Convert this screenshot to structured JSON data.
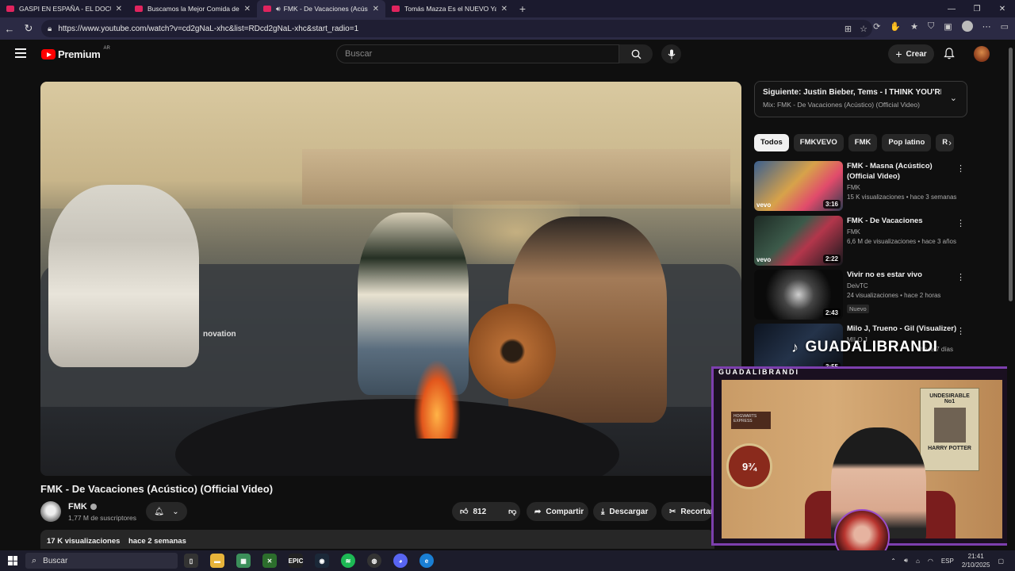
{
  "browser": {
    "tabs": [
      {
        "title": "GASPI EN ESPAÑA - EL DOCUMENTAL",
        "active": false,
        "audio": false
      },
      {
        "title": "Buscamos la Mejor Comida de España",
        "active": false,
        "audio": false
      },
      {
        "title": "FMK - De Vacaciones (Acústico)",
        "active": true,
        "audio": true
      },
      {
        "title": "Tomás Mazza Es el NUEVO Yao Cabrera",
        "active": false,
        "audio": false
      }
    ],
    "url": "https://www.youtube.com/watch?v=cd2gNaL-xhc&list=RDcd2gNaL-xhc&start_radio=1"
  },
  "youtube": {
    "logo_text": "Premium",
    "country": "AR",
    "search_placeholder": "Buscar",
    "create_label": "Crear"
  },
  "video": {
    "title": "FMK - De Vacaciones (Acústico) (Official Video)",
    "overlay_text": "novation",
    "channel": "FMK",
    "subscribers": "1,77 M de suscriptores",
    "likes": "812",
    "share_label": "Compartir",
    "download_label": "Descargar",
    "clip_label": "Recortar",
    "views": "17 K visualizaciones",
    "age": "hace 2 semanas"
  },
  "up_next": {
    "title": "Siguiente: Justin Bieber, Tems - I THINK YOU'RE SP...",
    "subtitle": "Mix: FMK - De Vacaciones (Acústico) (Official Video)"
  },
  "chips": [
    "Todos",
    "FMKVEVO",
    "FMK",
    "Pop latino",
    "R"
  ],
  "recommendations": [
    {
      "title": "FMK - Masna (Acústico) (Official Video)",
      "channel": "FMK",
      "meta": "15 K visualizaciones • hace 3 semanas",
      "duration": "3:16",
      "vevo": "vevo",
      "badge": ""
    },
    {
      "title": "FMK - De Vacaciones",
      "channel": "FMK",
      "meta": "6,6 M de visualizaciones • hace 3 años",
      "duration": "2:22",
      "vevo": "vevo",
      "badge": ""
    },
    {
      "title": "Vivir no es estar vivo",
      "channel": "DeivTC",
      "meta": "24 visualizaciones • hace 2 horas",
      "duration": "2:43",
      "vevo": "",
      "badge": "Nuevo"
    },
    {
      "title": "Milo J, Trueno - Gil (Visualizer)",
      "channel": "MILO J",
      "meta": "hace 7 días",
      "duration": "3:55",
      "vevo": "",
      "badge": ""
    }
  ],
  "overlay": {
    "tiktok_handle": "GUADALIBRANDI",
    "cam_label": "GUADALIBRANDI",
    "poster_lines": [
      "UNDESIRABLE",
      "No1",
      "HARRY POTTER"
    ],
    "platform_text": "9¾",
    "express_text": "HOGWARTS EXPRESS"
  },
  "taskbar": {
    "search_label": "Buscar",
    "lang": "ESP",
    "time": "21:41",
    "date": "2/10/2025"
  },
  "colors": {
    "yt_red": "#ff0000",
    "frame_purple": "#7d3fae"
  }
}
